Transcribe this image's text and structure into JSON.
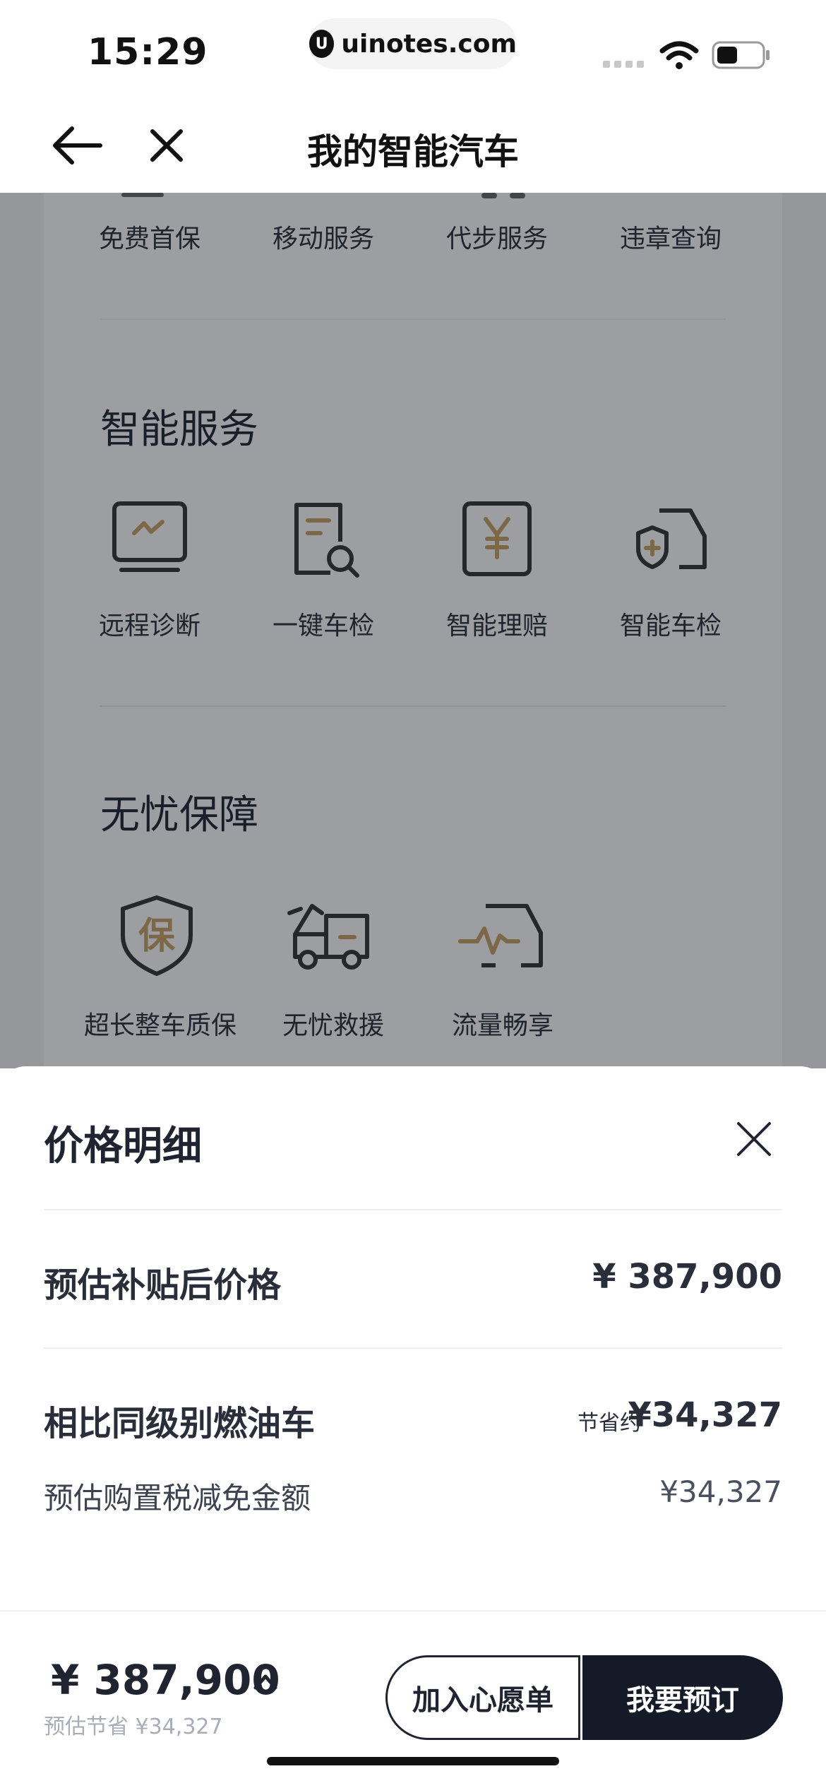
{
  "status_bar": {
    "time": "15:29",
    "url": "uinotes.com",
    "logo_glyph": "U"
  },
  "nav": {
    "title": "我的智能汽车",
    "back_icon": "arrow-left-icon",
    "close_icon": "close-icon"
  },
  "top_row": {
    "items": [
      "免费首保",
      "移动服务",
      "代步服务",
      "违章查询"
    ]
  },
  "smart_services": {
    "title": "智能服务",
    "items": [
      {
        "label": "远程诊断",
        "icon": "monitor-pulse-icon"
      },
      {
        "label": "一键车检",
        "icon": "document-search-icon"
      },
      {
        "label": "智能理赔",
        "icon": "yen-card-icon"
      },
      {
        "label": "智能车检",
        "icon": "car-shield-icon"
      }
    ]
  },
  "worry_free": {
    "title": "无忧保障",
    "items": [
      {
        "label": "超长整车质保",
        "icon": "warranty-shield-icon",
        "icon_text": "保"
      },
      {
        "label": "无忧救援",
        "icon": "tow-truck-icon"
      },
      {
        "label": "流量畅享",
        "icon": "car-pulse-icon"
      }
    ]
  },
  "sheet": {
    "title": "价格明细",
    "rows": {
      "subsidy_label": "预估补贴后价格",
      "subsidy_value": "¥ 387,900",
      "compare_label": "相比同级别燃油车",
      "compare_note": "节省约",
      "compare_value": "¥34,327",
      "tax_label": "预估购置税减免金额",
      "tax_value": "¥34,327"
    }
  },
  "footer": {
    "price": "¥ 387,900",
    "save_text": "预估节省 ¥34,327",
    "wish_button": "加入心愿单",
    "order_button": "我要预订"
  },
  "colors": {
    "accent_gold": "#c9a063",
    "dark": "#141a28",
    "overlay": "rgba(20,24,34,0.42)"
  }
}
